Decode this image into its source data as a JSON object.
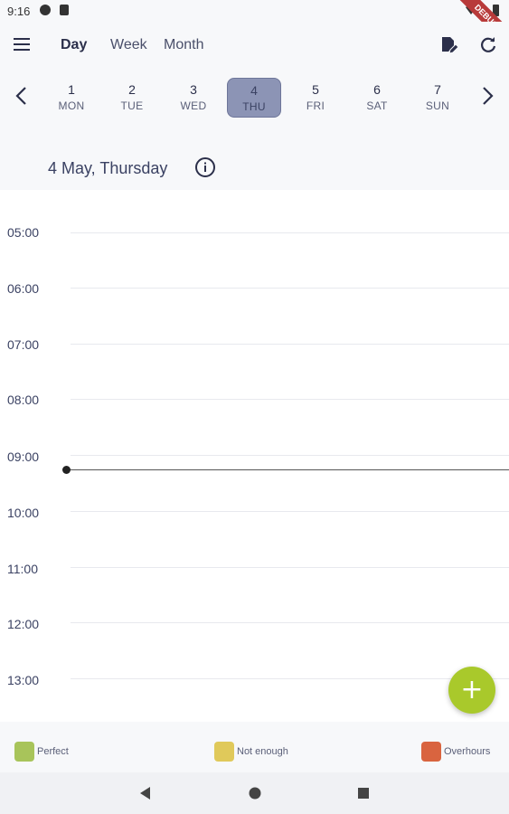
{
  "status_bar": {
    "time": "9:16",
    "ribbon": "DEBUG"
  },
  "app_bar": {
    "menu_icon": "menu-icon",
    "tabs": [
      {
        "label": "Day",
        "active": true
      },
      {
        "label": "Week",
        "active": false
      },
      {
        "label": "Month",
        "active": false
      }
    ],
    "actions": [
      "edit-document-icon",
      "refresh-icon"
    ]
  },
  "week": {
    "prev_icon": "chevron-left-icon",
    "next_icon": "chevron-right-icon",
    "days": [
      {
        "num": "1",
        "label": "MON"
      },
      {
        "num": "2",
        "label": "TUE"
      },
      {
        "num": "3",
        "label": "WED"
      },
      {
        "num": "4",
        "label": "THU",
        "selected": true
      },
      {
        "num": "5",
        "label": "FRI"
      },
      {
        "num": "6",
        "label": "SAT"
      },
      {
        "num": "7",
        "label": "SUN"
      }
    ]
  },
  "date_header": {
    "title": "4 May, Thursday",
    "info_icon": "info-icon"
  },
  "timeline": {
    "hours": [
      "05:00",
      "06:00",
      "07:00",
      "08:00",
      "09:00",
      "10:00",
      "11:00",
      "12:00",
      "13:00"
    ],
    "current_time_indicator": "now-line"
  },
  "fab": {
    "label": "+",
    "color": "#a9c92b"
  },
  "legend": [
    {
      "label": "Perfect",
      "color": "#a8c45a"
    },
    {
      "label": "Not enough",
      "color": "#e0c95a"
    },
    {
      "label": "Overhours",
      "color": "#d9643f"
    }
  ],
  "system_nav": [
    "back-icon",
    "home-icon",
    "recents-icon"
  ]
}
